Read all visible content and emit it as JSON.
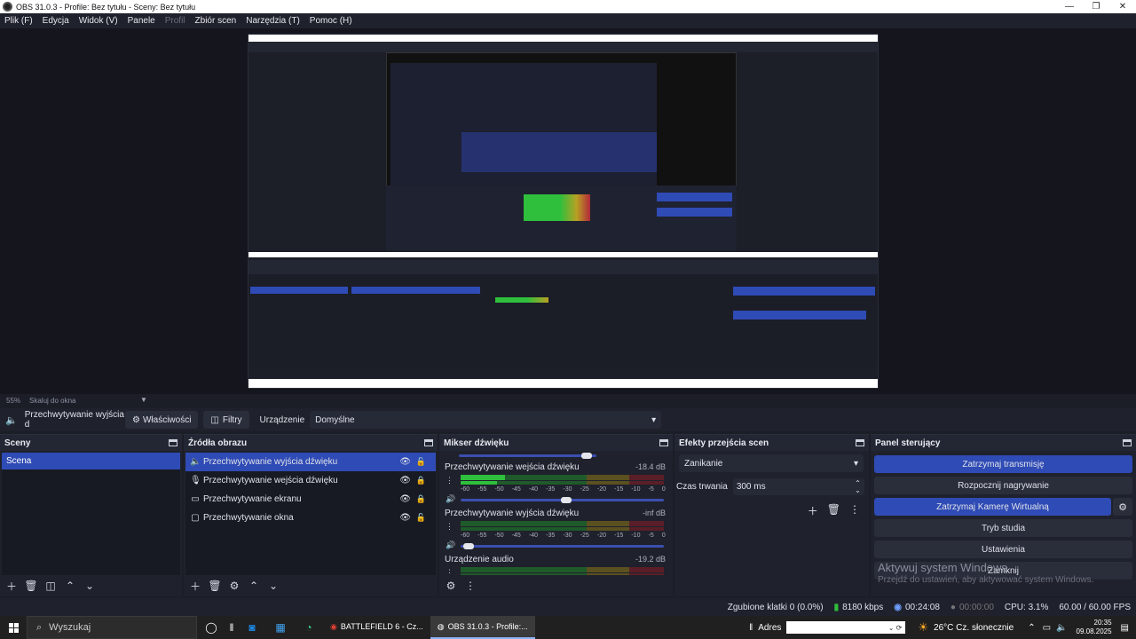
{
  "window": {
    "title": "OBS 31.0.3 - Profile: Bez tytułu - Sceny: Bez tytułu"
  },
  "menu": [
    "Plik (F)",
    "Edycja",
    "Widok (V)",
    "Panele",
    "Profil",
    "Zbiór scen",
    "Narzędzia (T)",
    "Pomoc (H)"
  ],
  "zoom": {
    "value": "55%",
    "label": "Skaluj do okna"
  },
  "context": {
    "source": "Przechwytywanie wyjścia d",
    "properties": "Właściwości",
    "filters": "Filtry",
    "device_label": "Urządzenie",
    "device_value": "Domyślne"
  },
  "scenes": {
    "title": "Sceny",
    "items": [
      "Scena"
    ]
  },
  "sources": {
    "title": "Źródła obrazu",
    "items": [
      {
        "icon": "speaker-icon",
        "label": "Przechwytywanie wyjścia dźwięku"
      },
      {
        "icon": "microphone-icon",
        "label": "Przechwytywanie wejścia dźwięku"
      },
      {
        "icon": "monitor-icon",
        "label": "Przechwytywanie ekranu"
      },
      {
        "icon": "window-icon",
        "label": "Przechwytywanie okna"
      }
    ]
  },
  "mixer": {
    "title": "Mikser dźwięku",
    "ticks": [
      "-60",
      "-55",
      "-50",
      "-45",
      "-40",
      "-35",
      "-30",
      "-25",
      "-20",
      "-15",
      "-10",
      "-5",
      "0"
    ],
    "channels": [
      {
        "name": "Przechwytywanie wejścia dźwięku",
        "db": "-18.4 dB",
        "level": 0.22,
        "volume": 0.52
      },
      {
        "name": "Przechwytywanie wyjścia dźwięku",
        "db": "-inf dB",
        "level": 0.0,
        "volume": 0.04
      },
      {
        "name": "Urządzenie audio",
        "db": "-19.2 dB",
        "level": 0.0,
        "volume": 0.0
      }
    ]
  },
  "transitions": {
    "title": "Efekty przejścia scen",
    "selected": "Zanikanie",
    "duration_label": "Czas trwania",
    "duration": "300 ms"
  },
  "controls": {
    "title": "Panel sterujący",
    "stop_stream": "Zatrzymaj transmisję",
    "start_record": "Rozpocznij nagrywanie",
    "stop_vcam": "Zatrzymaj Kamerę Wirtualną",
    "studio": "Tryb studia",
    "settings": "Ustawienia",
    "exit": "Zamknij"
  },
  "activation": {
    "title": "Aktywuj system Windows",
    "subtitle": "Przejdź do ustawień, aby aktywować system Windows."
  },
  "status": {
    "dropped": "Zgubione klatki 0 (0.0%)",
    "bitrate": "8180 kbps",
    "stream_time": "00:24:08",
    "rec_time": "00:00:00",
    "cpu": "CPU: 3.1%",
    "fps": "60.00 / 60.00 FPS"
  },
  "taskbar": {
    "search": "Wyszukaj",
    "tasks": [
      "BATTLEFIELD 6 - Cz...",
      "OBS 31.0.3 - Profile:..."
    ],
    "address_label": "Adres",
    "weather": "26°C  Cz. słonecznie",
    "time": "20:35",
    "date": "09.08.2025"
  },
  "colors": {
    "accent": "#2f4bb5",
    "panel": "#1f212c",
    "meter_green": "#2fbf3c",
    "meter_yellow": "#b9a023",
    "meter_red": "#b3283a"
  }
}
